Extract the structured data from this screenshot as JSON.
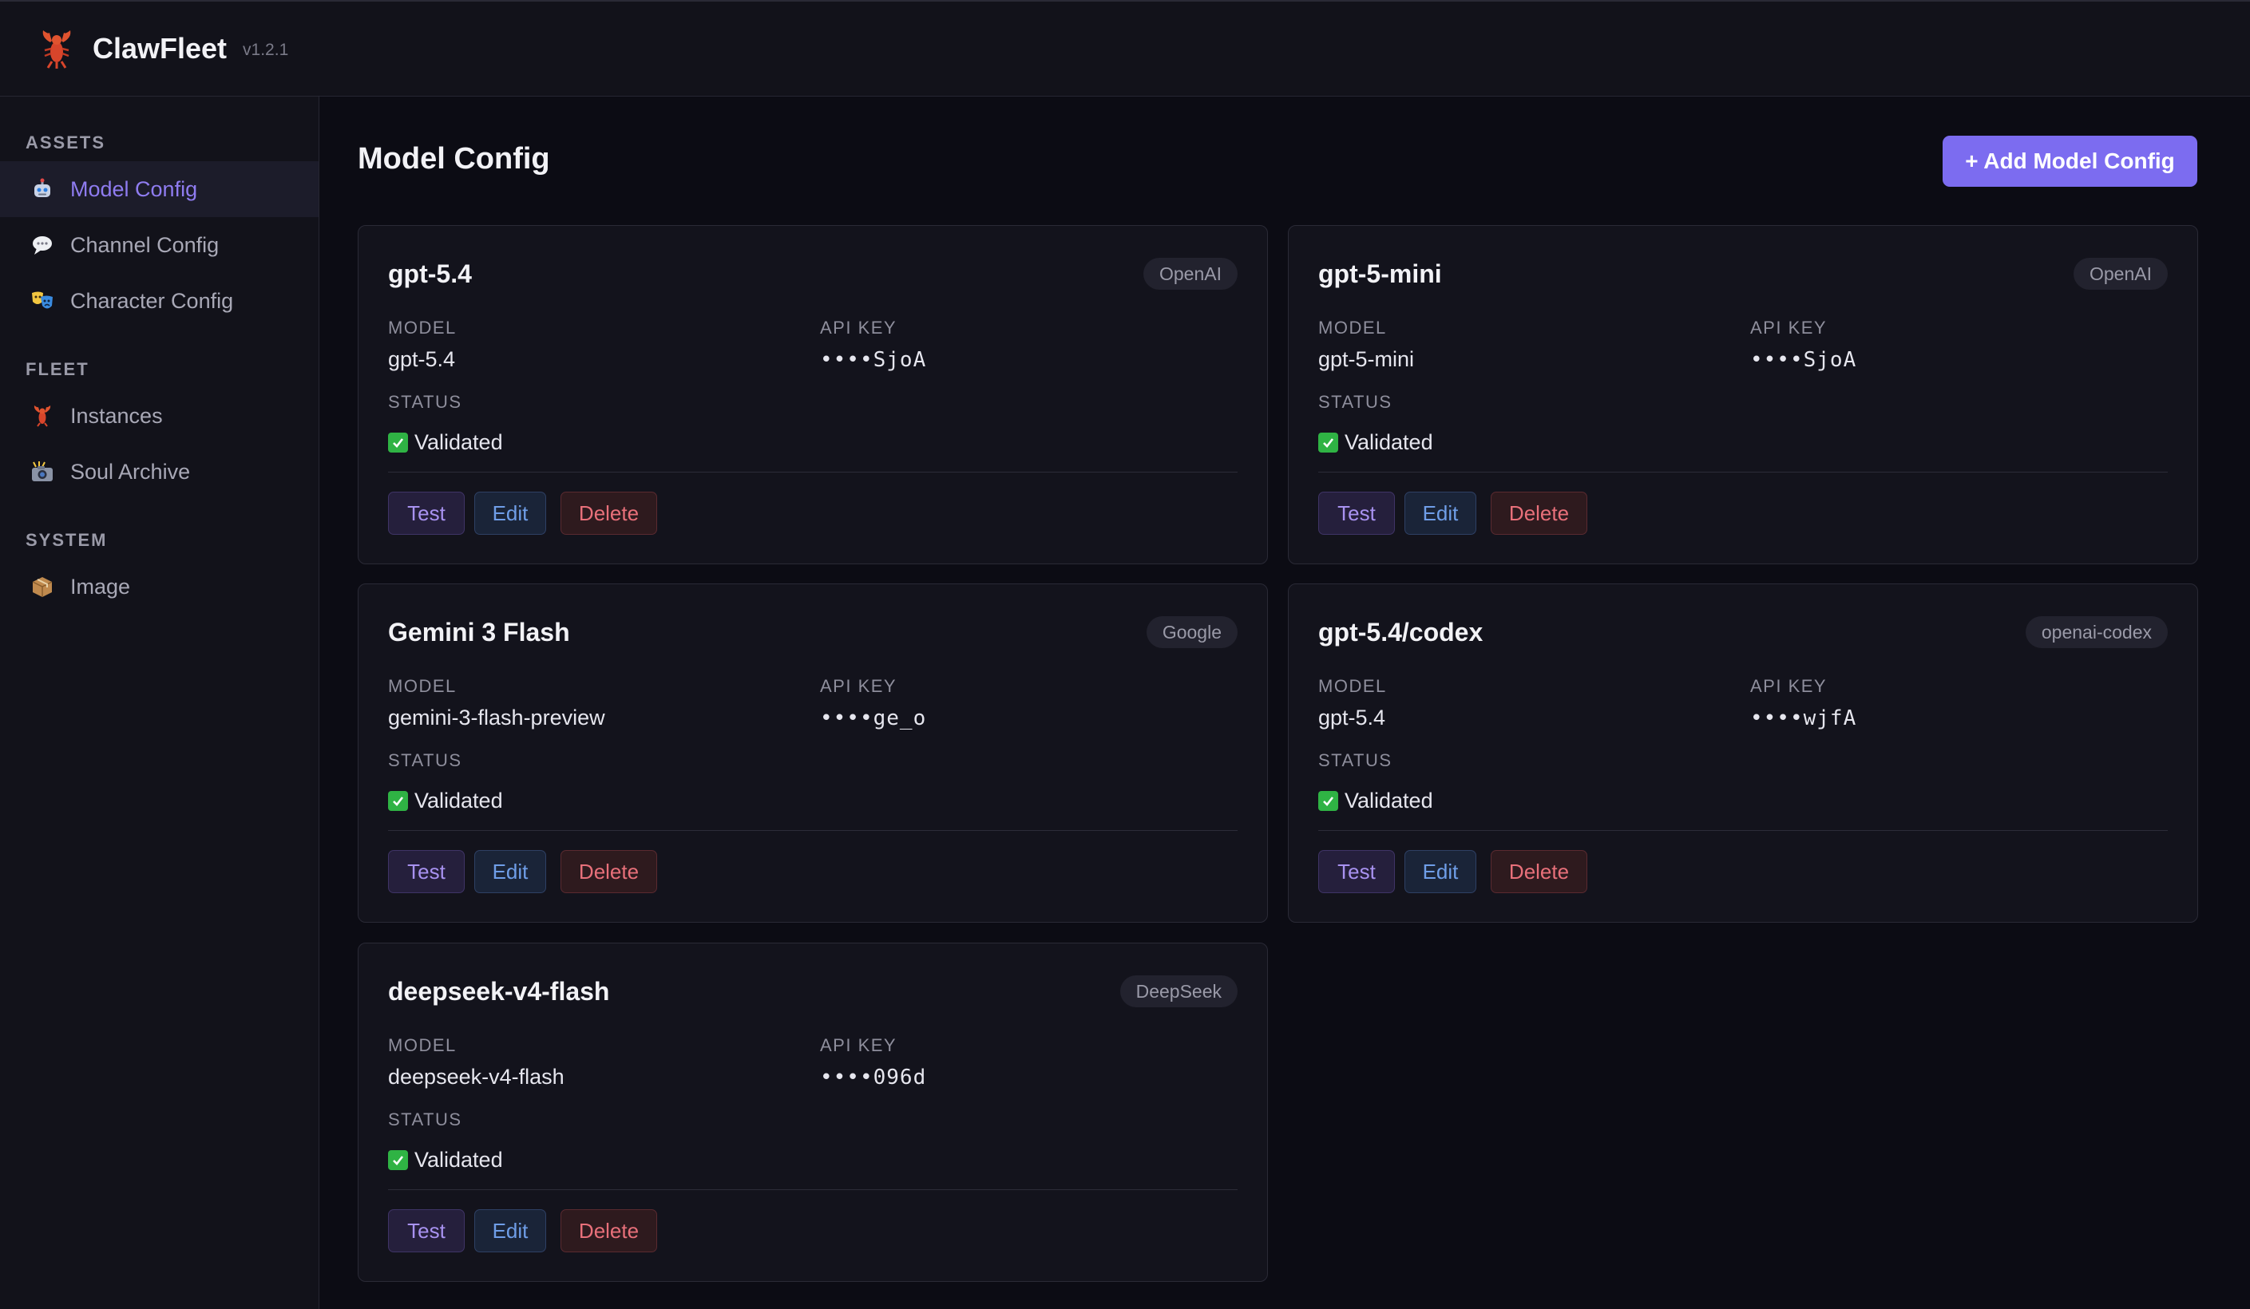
{
  "header": {
    "app_name": "ClawFleet",
    "version": "v1.2.1",
    "logo_icon": "lobster-icon"
  },
  "sidebar": {
    "sections": [
      {
        "label": "ASSETS",
        "items": [
          {
            "label": "Model Config",
            "icon": "robot-icon",
            "active": true
          },
          {
            "label": "Channel Config",
            "icon": "speech-bubble-icon",
            "active": false
          },
          {
            "label": "Character Config",
            "icon": "theater-masks-icon",
            "active": false
          }
        ]
      },
      {
        "label": "FLEET",
        "items": [
          {
            "label": "Instances",
            "icon": "lobster-icon",
            "active": false
          },
          {
            "label": "Soul Archive",
            "icon": "camera-flash-icon",
            "active": false
          }
        ]
      },
      {
        "label": "SYSTEM",
        "items": [
          {
            "label": "Image",
            "icon": "package-icon",
            "active": false
          }
        ]
      }
    ]
  },
  "main": {
    "title": "Model Config",
    "add_button_label": "+ Add Model Config",
    "field_labels": {
      "model": "MODEL",
      "api_key": "API KEY",
      "status": "STATUS"
    },
    "actions": {
      "test": "Test",
      "edit": "Edit",
      "delete": "Delete"
    },
    "cards": [
      {
        "name": "gpt-5.4",
        "provider": "OpenAI",
        "model": "gpt-5.4",
        "api_key": "••••SjoA",
        "status": "Validated"
      },
      {
        "name": "gpt-5-mini",
        "provider": "OpenAI",
        "model": "gpt-5-mini",
        "api_key": "••••SjoA",
        "status": "Validated"
      },
      {
        "name": "Gemini 3 Flash",
        "provider": "Google",
        "model": "gemini-3-flash-preview",
        "api_key": "••••ge_o",
        "status": "Validated"
      },
      {
        "name": "gpt-5.4/codex",
        "provider": "openai-codex",
        "model": "gpt-5.4",
        "api_key": "••••wjfA",
        "status": "Validated"
      },
      {
        "name": "deepseek-v4-flash",
        "provider": "DeepSeek",
        "model": "deepseek-v4-flash",
        "api_key": "••••096d",
        "status": "Validated"
      }
    ]
  },
  "colors": {
    "accent": "#7c6cf0",
    "background": "#0c0c14",
    "panel": "#13131c",
    "validated": "#2fb344",
    "delete": "#e8707a",
    "edit": "#6f9ee8"
  }
}
